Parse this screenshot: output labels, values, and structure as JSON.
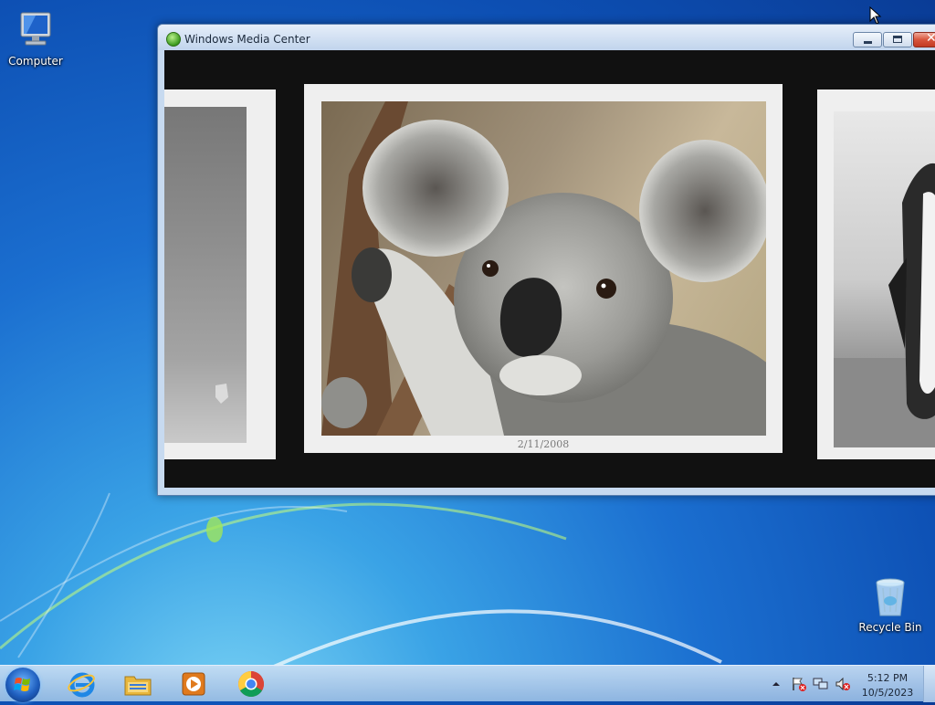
{
  "desktop": {
    "icons": [
      {
        "label": "Computer",
        "icon": "computer-icon"
      },
      {
        "label": "Recycle Bin",
        "icon": "recycle-bin-icon"
      }
    ]
  },
  "window": {
    "title": "Windows Media Center",
    "icon": "media-center-logo-icon",
    "slideshow": {
      "current_photo_date": "2/11/2008"
    }
  },
  "taskbar": {
    "pinned": [
      {
        "name": "Internet Explorer",
        "icon": "internet-explorer-icon"
      },
      {
        "name": "Windows Explorer",
        "icon": "folder-icon"
      },
      {
        "name": "Windows Media Player",
        "icon": "media-player-icon"
      },
      {
        "name": "Google Chrome",
        "icon": "chrome-icon"
      }
    ],
    "tray": {
      "time": "5:12 PM",
      "date": "10/5/2023"
    }
  },
  "colors": {
    "desktop_blue": "#1b6fd0",
    "slideshow_background": "#111111",
    "photo_mat": "#efefef",
    "close_button_red": "#c23a22"
  }
}
